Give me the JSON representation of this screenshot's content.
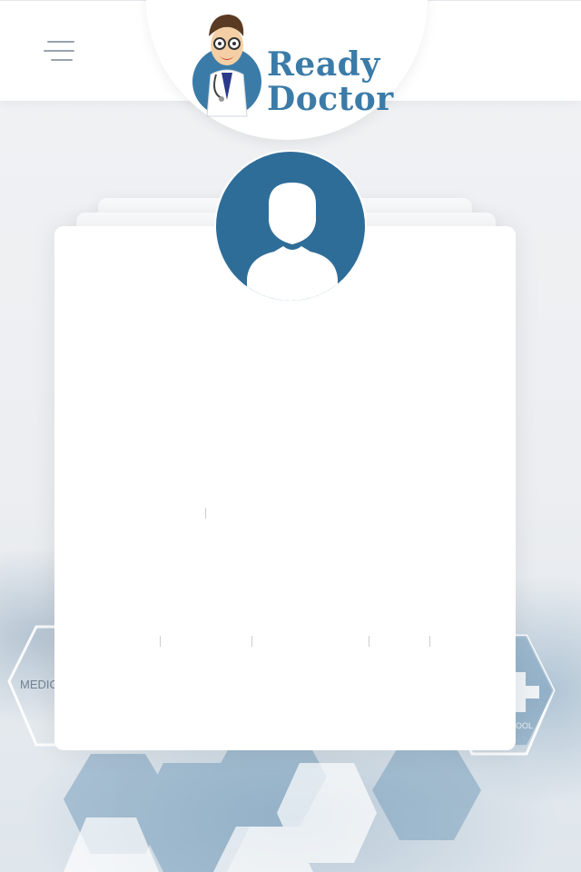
{
  "header": {
    "menu_icon": "hamburger-menu-icon",
    "logo": {
      "line1": "Ready",
      "line2": "Doctor",
      "mascot_icon": "doctor-mascot-icon",
      "brand_color": "#3b7ba8"
    }
  },
  "profile": {
    "avatar_icon": "user-silhouette-icon",
    "avatar_color": "#2f6d99"
  },
  "background": {
    "hex_labels": [
      "MEDIC",
      "OOL"
    ]
  }
}
